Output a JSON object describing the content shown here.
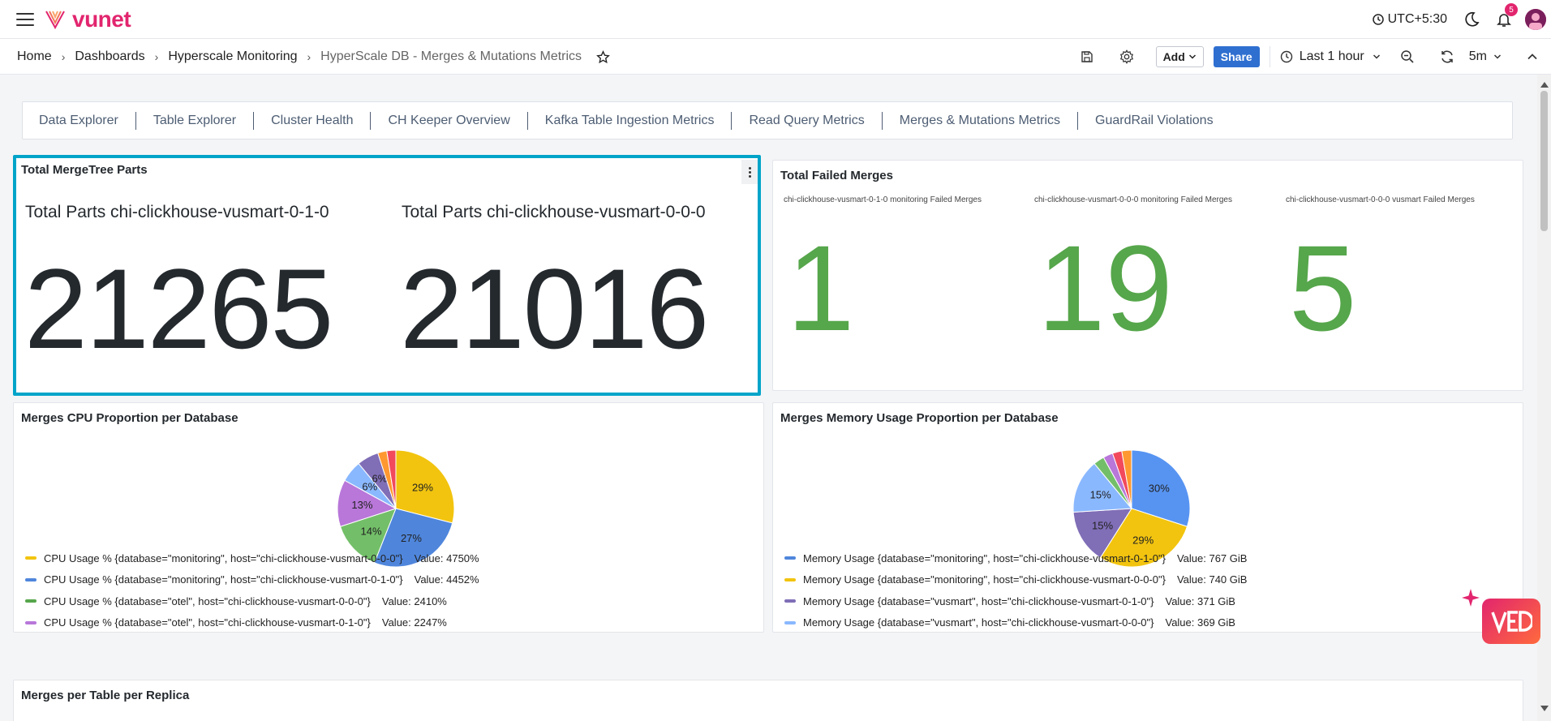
{
  "app": {
    "brand": "vunet",
    "timezone": "UTC+5:30",
    "notification_count": "5"
  },
  "breadcrumb": [
    {
      "label": "Home"
    },
    {
      "label": "Dashboards"
    },
    {
      "label": "Hyperscale Monitoring"
    },
    {
      "label": "HyperScale DB - Merges & Mutations Metrics"
    }
  ],
  "toolbar": {
    "add_label": "Add",
    "share_label": "Share",
    "time_range": "Last 1 hour",
    "refresh_interval": "5m"
  },
  "nav_links": [
    "Data Explorer",
    "Table Explorer",
    "Cluster Health",
    "CH Keeper Overview",
    "Kafka Table Ingestion Metrics",
    "Read Query Metrics",
    "Merges & Mutations Metrics",
    "GuardRail Violations"
  ],
  "panels": {
    "total_parts": {
      "title": "Total MergeTree Parts",
      "stats": [
        {
          "label": "Total Parts chi-clickhouse-vusmart-0-1-0",
          "value": "21265"
        },
        {
          "label": "Total Parts chi-clickhouse-vusmart-0-0-0",
          "value": "21016"
        }
      ]
    },
    "failed_merges": {
      "title": "Total Failed Merges",
      "color": "#56a64b",
      "stats": [
        {
          "label": "chi-clickhouse-vusmart-0-1-0 monitoring Failed Merges",
          "value": "1"
        },
        {
          "label": "chi-clickhouse-vusmart-0-0-0 monitoring Failed Merges",
          "value": "19"
        },
        {
          "label": "chi-clickhouse-vusmart-0-0-0 vusmart Failed Merges",
          "value": "5"
        }
      ]
    },
    "cpu_pie": {
      "title": "Merges CPU Proportion per Database",
      "legend": [
        {
          "label": "CPU Usage % {database=\"monitoring\", host=\"chi-clickhouse-vusmart-0-0-0\"}",
          "value": "Value: 4750%",
          "color": "#f2c40f"
        },
        {
          "label": "CPU Usage % {database=\"monitoring\", host=\"chi-clickhouse-vusmart-0-1-0\"}",
          "value": "Value: 4452%",
          "color": "#4f86dc"
        },
        {
          "label": "CPU Usage % {database=\"otel\", host=\"chi-clickhouse-vusmart-0-0-0\"}",
          "value": "Value: 2410%",
          "color": "#56a64b"
        },
        {
          "label": "CPU Usage % {database=\"otel\", host=\"chi-clickhouse-vusmart-0-1-0\"}",
          "value": "Value: 2247%",
          "color": "#b877d9"
        }
      ]
    },
    "mem_pie": {
      "title": "Merges Memory Usage Proportion per Database",
      "legend": [
        {
          "label": "Memory Usage {database=\"monitoring\", host=\"chi-clickhouse-vusmart-0-1-0\"}",
          "value": "Value: 767 GiB",
          "color": "#4f86dc"
        },
        {
          "label": "Memory Usage {database=\"monitoring\", host=\"chi-clickhouse-vusmart-0-0-0\"}",
          "value": "Value: 740 GiB",
          "color": "#f2c40f"
        },
        {
          "label": "Memory Usage {database=\"vusmart\", host=\"chi-clickhouse-vusmart-0-1-0\"}",
          "value": "Value: 371 GiB",
          "color": "#806eb7"
        },
        {
          "label": "Memory Usage {database=\"vusmart\", host=\"chi-clickhouse-vusmart-0-0-0\"}",
          "value": "Value: 369 GiB",
          "color": "#8ab8ff"
        }
      ]
    },
    "merges_table": {
      "title": "Merges per Table per Replica"
    }
  },
  "chart_data": [
    {
      "type": "pie",
      "title": "Merges CPU Proportion per Database",
      "slices": [
        {
          "value": 29,
          "label": "29%",
          "color": "#f2c40f"
        },
        {
          "value": 27,
          "label": "27%",
          "color": "#4f86dc"
        },
        {
          "value": 14,
          "label": "14%",
          "color": "#73bf69"
        },
        {
          "value": 13,
          "label": "13%",
          "color": "#b877d9"
        },
        {
          "value": 6,
          "label": "6%",
          "color": "#8ab8ff"
        },
        {
          "value": 6,
          "label": "6%",
          "color": "#806eb7"
        },
        {
          "value": 2.5,
          "label": "",
          "color": "#ff9830"
        },
        {
          "value": 2.5,
          "label": "",
          "color": "#f2495c"
        }
      ]
    },
    {
      "type": "pie",
      "title": "Merges Memory Usage Proportion per Database",
      "slices": [
        {
          "value": 30,
          "label": "30%",
          "color": "#5794f2"
        },
        {
          "value": 29,
          "label": "29%",
          "color": "#f2c40f"
        },
        {
          "value": 15,
          "label": "15%",
          "color": "#806eb7"
        },
        {
          "value": 15,
          "label": "15%",
          "color": "#8ab8ff"
        },
        {
          "value": 3,
          "label": "",
          "color": "#73bf69"
        },
        {
          "value": 2.7,
          "label": "",
          "color": "#b877d9"
        },
        {
          "value": 2.6,
          "label": "",
          "color": "#f2495c"
        },
        {
          "value": 2.7,
          "label": "",
          "color": "#ff9830"
        }
      ]
    }
  ]
}
